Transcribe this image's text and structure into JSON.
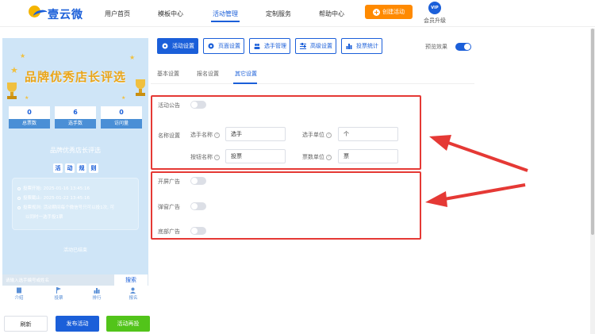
{
  "header": {
    "logo_text": "壹云微",
    "nav": [
      "用户首页",
      "模板中心",
      "活动管理",
      "定制服务",
      "帮助中心"
    ],
    "create_button": "创建活动",
    "vip_badge": "VIP",
    "vip_label": "会员升级"
  },
  "preview": {
    "banner_title": "品牌优秀店长评选",
    "stats": [
      {
        "value": "0",
        "label": "总票数"
      },
      {
        "value": "6",
        "label": "选手数"
      },
      {
        "value": "0",
        "label": "访问量"
      }
    ],
    "event_name": "品牌优秀店长评选",
    "rule_tags": [
      "活",
      "动",
      "规",
      "则"
    ],
    "info": [
      "投票开始: 2025-01-16 13:45:16",
      "投票截止: 2025-01-22 13:45:16",
      "投票规则: 活动期间每个微信号只可以投1次, 可",
      "以同时一选手投1票"
    ],
    "info_footer": "活动已结束",
    "search_placeholder": "请输入选手编号或姓名",
    "search_button": "搜索",
    "tabs": [
      "介绍",
      "投票",
      "排行",
      "报名"
    ]
  },
  "bottom_buttons": {
    "refresh": "刷新",
    "publish": "发布活动",
    "republish": "活动再投"
  },
  "toolbar": {
    "buttons": [
      "活动设置",
      "页面设置",
      "选手管理",
      "高级设置",
      "投票统计"
    ],
    "preview_label": "预览效果",
    "preview_on": true
  },
  "subtabs": [
    "基本设置",
    "报名设置",
    "其它设置"
  ],
  "settings": {
    "announcement_label": "活动公告",
    "announcement_on": false,
    "name_settings_label": "名称设置",
    "player_name_label": "选手名称",
    "player_name_value": "选手",
    "player_unit_label": "选手单位",
    "player_unit_value": "个",
    "button_name_label": "按钮名称",
    "button_name_value": "投票",
    "vote_unit_label": "票数单位",
    "vote_unit_value": "票",
    "ads": [
      {
        "label": "开屏广告",
        "on": false
      },
      {
        "label": "弹窗广告",
        "on": false
      },
      {
        "label": "底部广告",
        "on": false
      }
    ]
  },
  "colors": {
    "primary": "#1b5fd9",
    "accent_orange": "#ff8a00",
    "green": "#52c41a",
    "annotation_red": "#e53935"
  }
}
